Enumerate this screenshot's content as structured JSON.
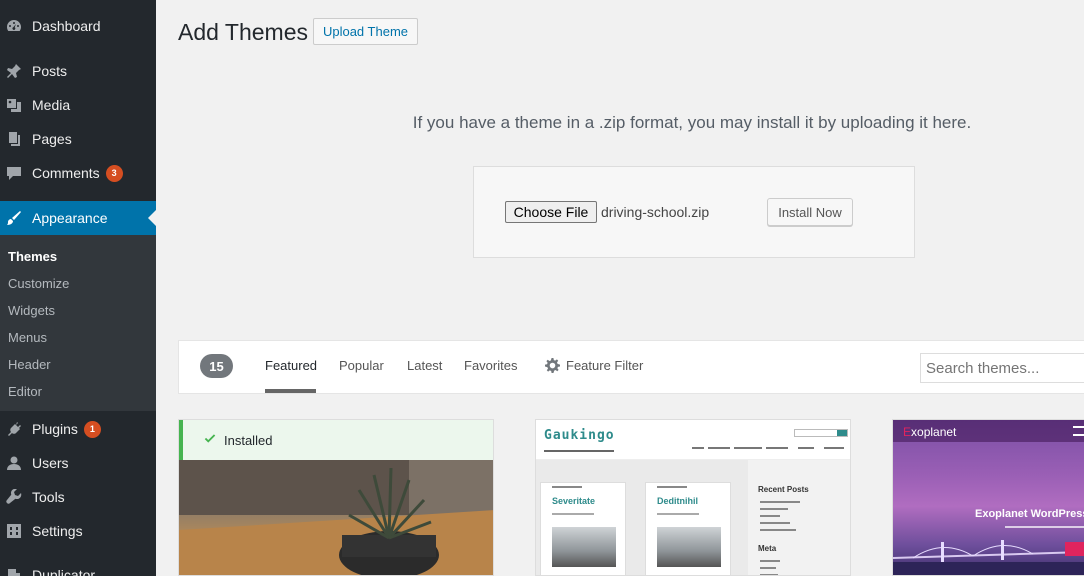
{
  "sidebar": {
    "items": [
      {
        "label": "Dashboard",
        "icon": "dashboard-icon"
      },
      {
        "label": "Posts",
        "icon": "pin-icon"
      },
      {
        "label": "Media",
        "icon": "media-icon"
      },
      {
        "label": "Pages",
        "icon": "pages-icon"
      },
      {
        "label": "Comments",
        "icon": "comment-icon",
        "badge": "3"
      },
      {
        "label": "Appearance",
        "icon": "paintbrush-icon"
      },
      {
        "label": "Plugins",
        "icon": "plug-icon",
        "badge": "1"
      },
      {
        "label": "Users",
        "icon": "user-icon"
      },
      {
        "label": "Tools",
        "icon": "wrench-icon"
      },
      {
        "label": "Settings",
        "icon": "settings-icon"
      },
      {
        "label": "Duplicator",
        "icon": "duplicator-icon"
      }
    ],
    "submenu": [
      "Themes",
      "Customize",
      "Widgets",
      "Menus",
      "Header",
      "Editor"
    ],
    "active_color": "#0073aa"
  },
  "page": {
    "title": "Add Themes",
    "upload_button": "Upload Theme"
  },
  "upload": {
    "description": "If you have a theme in a .zip format, you may install it by uploading it here.",
    "choose_label": "Choose File",
    "file_name": "driving-school.zip",
    "install_label": "Install Now"
  },
  "filter": {
    "count": "15",
    "links": [
      "Featured",
      "Popular",
      "Latest",
      "Favorites"
    ],
    "feature_filter": "Feature Filter",
    "search_placeholder": "Search themes..."
  },
  "themes": [
    {
      "status": "Installed"
    },
    {
      "logo": "Gaukingo",
      "posts": [
        "Severitate",
        "Deditnihil"
      ],
      "sidebar_titles": [
        "Recent Posts",
        "Meta"
      ]
    },
    {
      "logo_e": "E",
      "logo_rest": "xoplanet",
      "headline": "Exoplanet WordPress"
    }
  ]
}
